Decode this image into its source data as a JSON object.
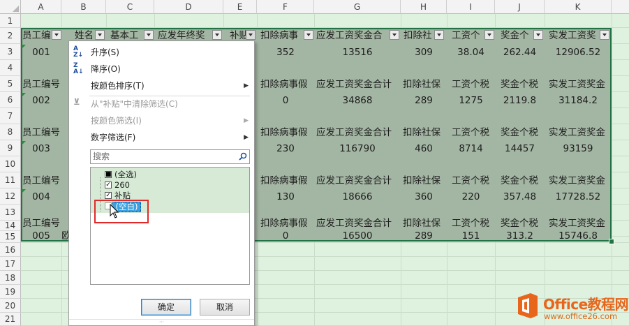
{
  "columns": [
    "A",
    "B",
    "C",
    "D",
    "E",
    "F",
    "G",
    "H",
    "I",
    "J",
    "K"
  ],
  "rows": [
    "1",
    "2",
    "3",
    "4",
    "5",
    "6",
    "7",
    "8",
    "9",
    "10",
    "11",
    "12",
    "13",
    "14",
    "15",
    "16",
    "17",
    "18",
    "19",
    "20",
    "21",
    "22"
  ],
  "header_row": {
    "A": "员工编",
    "B": "姓名",
    "C": "基本工",
    "D": "应发年终奖",
    "E": "补贴",
    "F": "扣除病事",
    "G": "应发工资奖金合",
    "H": "扣除社",
    "I": "工资个",
    "J": "奖金个",
    "K": "实发工资奖"
  },
  "repeated_header": {
    "A": "员工编号",
    "F": "扣除病事假",
    "G": "应发工资奖金合计",
    "H": "扣除社保",
    "I": "工资个税",
    "J": "奖金个税",
    "K": "实发工资奖金"
  },
  "records": [
    {
      "A": "001",
      "F": "352",
      "G": "13516",
      "H": "309",
      "I": "38.04",
      "J": "262.44",
      "K": "12906.52"
    },
    {
      "A": "002",
      "F": "0",
      "G": "34868",
      "H": "289",
      "I": "1275",
      "J": "2119.8",
      "K": "31184.2"
    },
    {
      "A": "003",
      "F": "230",
      "G": "116790",
      "H": "460",
      "I": "8714",
      "J": "14457",
      "K": "93159"
    },
    {
      "A": "004",
      "F": "130",
      "G": "18666",
      "H": "360",
      "I": "220",
      "J": "357.48",
      "K": "17728.52"
    },
    {
      "A": "005",
      "B": "欧",
      "F": "0",
      "G": "16500",
      "H": "289",
      "I": "151",
      "J": "313.2",
      "K": "15746.8"
    }
  ],
  "filter_menu": {
    "sort_asc": "升序(S)",
    "sort_desc": "降序(O)",
    "sort_by_color": "按颜色排序(T)",
    "clear_filter": "从\"补贴\"中清除筛选(C)",
    "filter_by_color": "按颜色筛选(I)",
    "number_filter": "数字筛选(F)",
    "search_placeholder": "搜索",
    "items": [
      {
        "label": "(全选)",
        "state": "indeterminate"
      },
      {
        "label": "260",
        "state": "checked"
      },
      {
        "label": "补贴",
        "state": "checked"
      },
      {
        "label": "(空白)",
        "state": "unchecked"
      }
    ],
    "ok_label": "确定",
    "cancel_label": "取消"
  },
  "watermark": {
    "title": "Office教程网",
    "url": "www.office26.com"
  },
  "colors": {
    "selection_fill": "#a3b5a3",
    "selection_border": "#217346",
    "highlight_box": "#e02a2a",
    "watermark": "#e8661b"
  }
}
